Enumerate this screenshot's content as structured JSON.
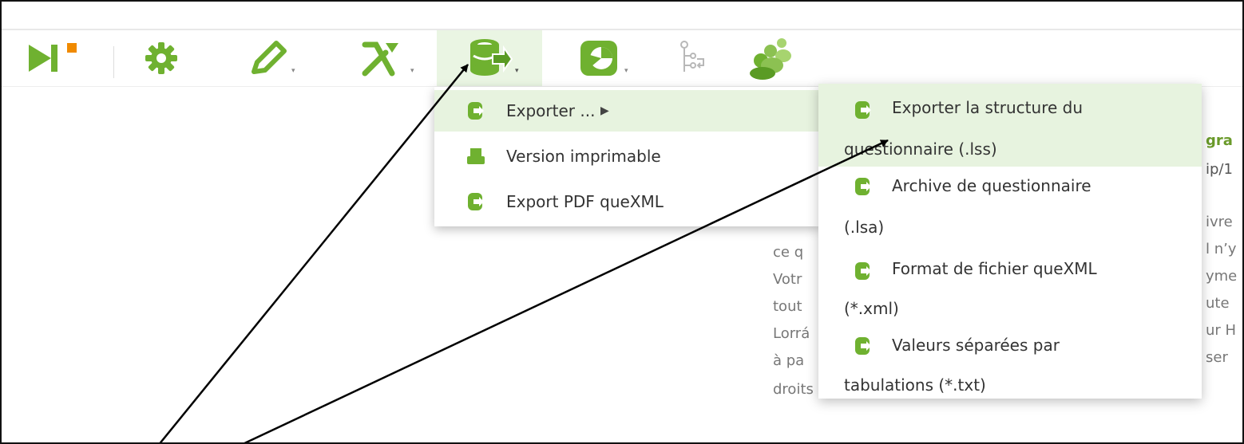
{
  "toolbar": {
    "buttons": [
      {
        "name": "preview-survey-button",
        "icon": "play-stop-icon"
      },
      {
        "name": "settings-button",
        "icon": "gear-icon"
      },
      {
        "name": "edit-button",
        "icon": "pencil-icon"
      },
      {
        "name": "tools-button",
        "icon": "tools-icon"
      },
      {
        "name": "display-export-button",
        "icon": "database-export-icon"
      },
      {
        "name": "responses-button",
        "icon": "chart-icon"
      },
      {
        "name": "logic-button",
        "icon": "tree-icon"
      },
      {
        "name": "participants-button",
        "icon": "people-icon"
      }
    ]
  },
  "menu_main": {
    "items": [
      {
        "label": "Exporter ...",
        "has_submenu": true
      },
      {
        "label": "Version imprimable"
      },
      {
        "label": "Export PDF queXML"
      }
    ]
  },
  "submenu_export": {
    "items": [
      {
        "line1": "Exporter la structure du",
        "line2": "questionnaire (.lss)"
      },
      {
        "line1": "Archive de questionnaire",
        "line2": "(.lsa)"
      },
      {
        "line1": "Format de fichier queXML",
        "line2": "(*.xml)"
      },
      {
        "line1": "Valeurs séparées par",
        "line2": "tabulations (*.txt)"
      }
    ]
  },
  "page_text": {
    "line1": "ce q",
    "line2": "Votr",
    "line3": "tout",
    "line4": "Lorrá",
    "line5": "à pa",
    "line6": "droits ni ne dégage les chercheurs de leurs r",
    "right1": "gra",
    "right2": "ip/1",
    "right3": "ivre",
    "right4": "l n’y",
    "right5": "yme",
    "right6": "ute",
    "right7": "ur H",
    "right8": "ser"
  },
  "colors": {
    "accent_green": "#6fb130",
    "highlight": "#e7f3df",
    "orange": "#f08a00"
  }
}
